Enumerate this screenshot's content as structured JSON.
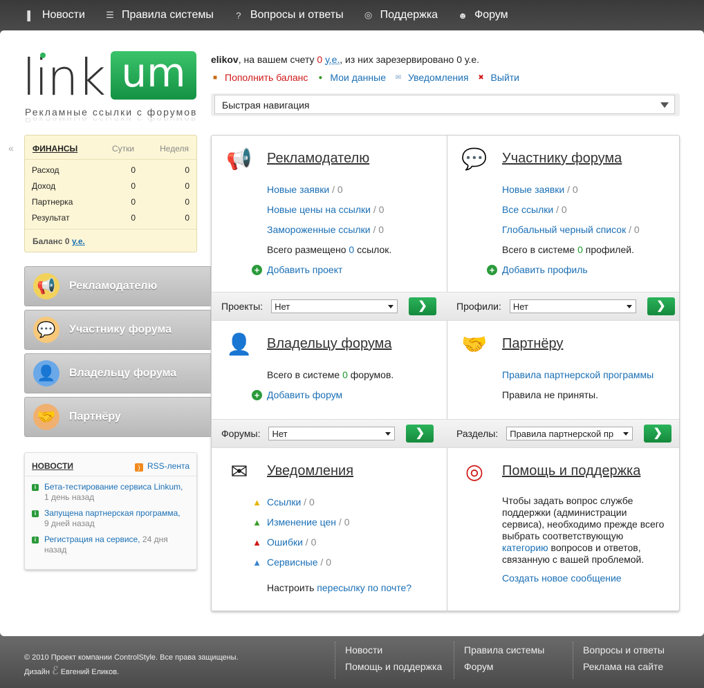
{
  "topnav": [
    {
      "icon": "book-icon",
      "glyph": "▌",
      "label": "Новости"
    },
    {
      "icon": "document-icon",
      "glyph": "☰",
      "label": "Правила системы"
    },
    {
      "icon": "question-icon",
      "glyph": "?",
      "label": "Вопросы и ответы"
    },
    {
      "icon": "lifebuoy-icon",
      "glyph": "◎",
      "label": "Поддержка"
    },
    {
      "icon": "users-icon",
      "glyph": "☻",
      "label": "Форум"
    }
  ],
  "logo": {
    "text_link": "link",
    "text_um": "um",
    "tagline": "Рекламные ссылки с форумов"
  },
  "user": {
    "name": "elikov",
    "text1": ", на вашем счету ",
    "balance": "0",
    "currency": "у.е.",
    "text2": ", из них зарезервировано 0 у.е."
  },
  "account_links": [
    {
      "icon": "wallet-icon",
      "glyph": "■",
      "label": "Пополнить баланс",
      "color": "#d01818"
    },
    {
      "icon": "user-icon",
      "glyph": "●",
      "label": "Мои данные",
      "color": "#1a6fb5"
    },
    {
      "icon": "mail-icon",
      "glyph": "✉",
      "label": "Уведомления",
      "color": "#1a6fb5"
    },
    {
      "icon": "close-icon",
      "glyph": "✖",
      "label": "Выйти",
      "color": "#1a6fb5"
    }
  ],
  "quick_nav": {
    "placeholder": "Быстрая навигация"
  },
  "collapse_glyph": "«",
  "finance": {
    "title": "ФИНАНСЫ",
    "col1": "Сутки",
    "col2": "Неделя",
    "rows": [
      {
        "label": "Расход",
        "day": "0",
        "week": "0"
      },
      {
        "label": "Доход",
        "day": "0",
        "week": "0"
      },
      {
        "label": "Партнерка",
        "day": "0",
        "week": "0"
      },
      {
        "label": "Результат",
        "day": "0",
        "week": "0"
      }
    ],
    "balance_label": "Баланс 0",
    "balance_currency": "у.е."
  },
  "side_buttons": [
    {
      "label": "Рекламодателю",
      "icon": "megaphone-icon",
      "glyph": "📢"
    },
    {
      "label": "Участнику форума",
      "icon": "chat-user-icon",
      "glyph": "💬"
    },
    {
      "label": "Владельцу форума",
      "icon": "owner-icon",
      "glyph": "👤"
    },
    {
      "label": "Партнёру",
      "icon": "handshake-icon",
      "glyph": "🤝"
    }
  ],
  "news": {
    "title": "НОВОСТИ",
    "rss": "RSS-лента",
    "items": [
      {
        "link": "Бета-тестирование сервиса Linkum,",
        "date": "1 день назад"
      },
      {
        "link": "Запущена партнерская программа,",
        "date": "9 дней назад"
      },
      {
        "link": "Регистрация на сервисе,",
        "date": "24 дня назад"
      }
    ]
  },
  "cards": {
    "advertiser": {
      "title": "Рекламодателю",
      "links": [
        {
          "label": "Новые заявки",
          "count": " / 0"
        },
        {
          "label": "Новые цены на ссылки",
          "count": " / 0"
        },
        {
          "label": "Замороженные ссылки",
          "count": " / 0"
        }
      ],
      "total_pre": "Всего размещено ",
      "total_val": "0",
      "total_post": " ссылок.",
      "add": "Добавить проект",
      "bar_label": "Проекты:",
      "bar_value": "Нет"
    },
    "participant": {
      "title": "Участнику форума",
      "links": [
        {
          "label": "Новые заявки",
          "count": " / 0"
        },
        {
          "label": "Все ссылки",
          "count": " / 0"
        },
        {
          "label": "Глобальный черный список",
          "count": " / 0"
        }
      ],
      "total_pre": "Всего в системе ",
      "total_val": "0",
      "total_post": " профилей.",
      "add": "Добавить профиль",
      "bar_label": "Профили:",
      "bar_value": "Нет"
    },
    "owner": {
      "title": "Владельцу форума",
      "total_pre": "Всего в системе ",
      "total_val": "0",
      "total_post": " форумов.",
      "add": "Добавить форум",
      "bar_label": "Форумы:",
      "bar_value": "Нет"
    },
    "partner": {
      "title": "Партнёру",
      "rules": "Правила партнерской программы",
      "status": "Правила не приняты.",
      "bar_label": "Разделы:",
      "bar_value": "Правила партнерской пр"
    },
    "notifications": {
      "title": "Уведомления",
      "links": [
        {
          "label": "Ссылки",
          "count": " / 0",
          "icon": "warning-yellow-icon",
          "color": "#e8b400"
        },
        {
          "label": "Изменение цен",
          "count": " / 0",
          "icon": "warning-green-icon",
          "color": "#3aa02a"
        },
        {
          "label": "Ошибки",
          "count": " / 0",
          "icon": "warning-red-icon",
          "color": "#d01818"
        },
        {
          "label": "Сервисные",
          "count": " / 0",
          "icon": "warning-blue-icon",
          "color": "#3a86d0"
        }
      ],
      "mail_pre": "Настроить ",
      "mail_link": "пересылку по почте?"
    },
    "help": {
      "title": "Помощь и поддержка",
      "text1": "Чтобы задать вопрос службе поддержки (администрации сервиса), необходимо прежде всего выбрать соответствующую",
      "cat_link": "категорию",
      "text2": " вопросов и ответов, связанную с вашей проблемой.",
      "new_msg": "Создать новое сообщение"
    }
  },
  "go_glyph": "❯",
  "plus_glyph": "+",
  "warn_glyph": "▲",
  "footer": {
    "copyright": "© 2010 Проект компании ControlStyle. Все права защищены.",
    "design": "Дизайн",
    "design_glyph": "ℰ",
    "designer": "Евгений Еликов.",
    "col1": [
      "Новости",
      "Помощь и поддержка"
    ],
    "col2": [
      "Правила системы",
      "Форум"
    ],
    "col3": [
      "Вопросы и ответы",
      "Реклама на сайте"
    ]
  },
  "colors": {
    "accent": "#1a6fb5",
    "green": "#1a9a2a",
    "red": "#d01818"
  }
}
